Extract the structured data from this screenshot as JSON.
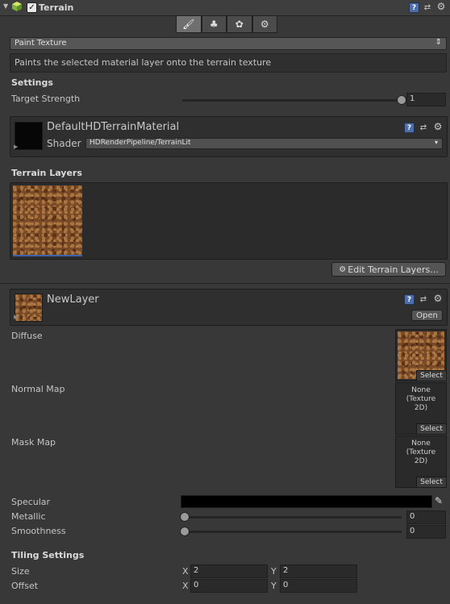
{
  "header": {
    "title": "Terrain",
    "enabled": true,
    "icons": [
      "unity-cube-icon",
      "help-icon",
      "preset-icon",
      "gear-icon"
    ]
  },
  "toolbar": {
    "tools": [
      {
        "name": "paint-texture-tool",
        "icon": "brush-icon",
        "glyph": "🖌",
        "active": true
      },
      {
        "name": "place-trees-tool",
        "icon": "tree-icon",
        "glyph": "♣",
        "active": false
      },
      {
        "name": "paint-details-tool",
        "icon": "details-icon",
        "glyph": "✿",
        "active": false
      },
      {
        "name": "terrain-settings-tool",
        "icon": "gear-icon",
        "glyph": "⚙",
        "active": false
      }
    ]
  },
  "mode": {
    "selected": "Paint Texture",
    "description": "Paints the selected material layer onto the terrain texture"
  },
  "settings": {
    "title": "Settings",
    "target_strength_label": "Target Strength",
    "target_strength_value": "1",
    "target_strength_fraction": 1
  },
  "material": {
    "name": "DefaultHDTerrainMaterial",
    "shader_label": "Shader",
    "shader_value": "HDRenderPipeline/TerrainLit"
  },
  "terrain_layers": {
    "title": "Terrain Layers",
    "edit_button": "Edit Terrain Layers..."
  },
  "layer": {
    "name": "NewLayer",
    "open_button": "Open",
    "diffuse_label": "Diffuse",
    "normal_map_label": "Normal Map",
    "mask_map_label": "Mask Map",
    "none_texture_text": "None\n(Texture\n2D)",
    "select_label": "Select",
    "specular_label": "Specular",
    "specular_color": "#000000",
    "metallic_label": "Metallic",
    "metallic_value": "0",
    "smoothness_label": "Smoothness",
    "smoothness_value": "0"
  },
  "tiling": {
    "title": "Tiling Settings",
    "size_label": "Size",
    "offset_label": "Offset",
    "x_label": "X",
    "y_label": "Y",
    "size_x": "2",
    "size_y": "2",
    "offset_x": "0",
    "offset_y": "0"
  },
  "colors": {
    "background": "#383838",
    "accent_blue": "#3d63a8"
  }
}
